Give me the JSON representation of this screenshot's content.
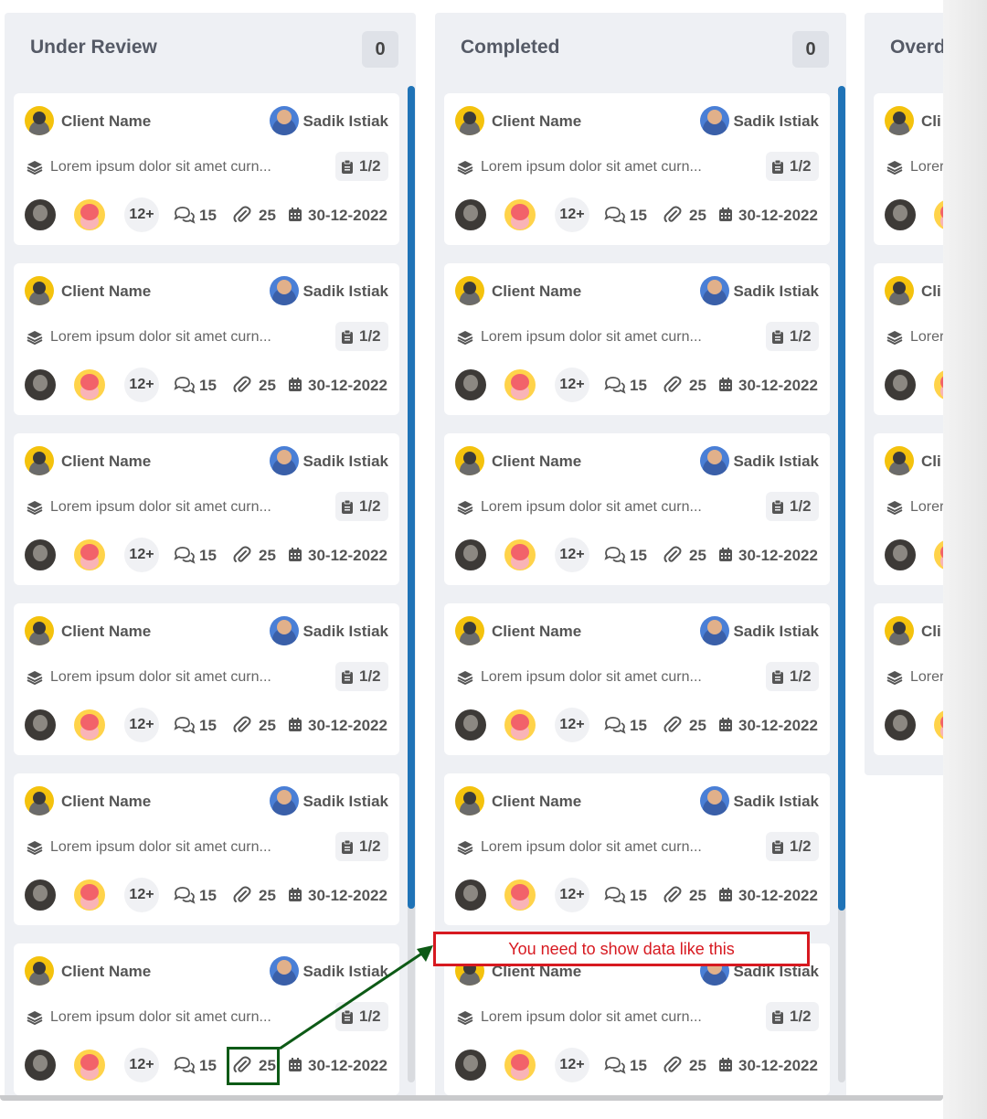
{
  "columns": [
    {
      "title": "Under Review",
      "count": "0",
      "cards": [
        {
          "client": "Client Name",
          "assignee": "Sadik Istiak",
          "description": "Lorem ipsum dolor sit amet curn...",
          "checklist": "1/2",
          "members_more": "12+",
          "comments": "15",
          "attachments": "25",
          "date": "30-12-2022"
        },
        {
          "client": "Client Name",
          "assignee": "Sadik Istiak",
          "description": "Lorem ipsum dolor sit amet curn...",
          "checklist": "1/2",
          "members_more": "12+",
          "comments": "15",
          "attachments": "25",
          "date": "30-12-2022"
        },
        {
          "client": "Client Name",
          "assignee": "Sadik Istiak",
          "description": "Lorem ipsum dolor sit amet curn...",
          "checklist": "1/2",
          "members_more": "12+",
          "comments": "15",
          "attachments": "25",
          "date": "30-12-2022"
        },
        {
          "client": "Client Name",
          "assignee": "Sadik Istiak",
          "description": "Lorem ipsum dolor sit amet curn...",
          "checklist": "1/2",
          "members_more": "12+",
          "comments": "15",
          "attachments": "25",
          "date": "30-12-2022"
        },
        {
          "client": "Client Name",
          "assignee": "Sadik Istiak",
          "description": "Lorem ipsum dolor sit amet curn...",
          "checklist": "1/2",
          "members_more": "12+",
          "comments": "15",
          "attachments": "25",
          "date": "30-12-2022"
        },
        {
          "client": "Client Name",
          "assignee": "Sadik Istiak",
          "description": "Lorem ipsum dolor sit amet curn...",
          "checklist": "1/2",
          "members_more": "12+",
          "comments": "15",
          "attachments": "25",
          "date": "30-12-2022"
        }
      ]
    },
    {
      "title": "Completed",
      "count": "0",
      "cards": [
        {
          "client": "Client Name",
          "assignee": "Sadik Istiak",
          "description": "Lorem ipsum dolor sit amet curn...",
          "checklist": "1/2",
          "members_more": "12+",
          "comments": "15",
          "attachments": "25",
          "date": "30-12-2022"
        },
        {
          "client": "Client Name",
          "assignee": "Sadik Istiak",
          "description": "Lorem ipsum dolor sit amet curn...",
          "checklist": "1/2",
          "members_more": "12+",
          "comments": "15",
          "attachments": "25",
          "date": "30-12-2022"
        },
        {
          "client": "Client Name",
          "assignee": "Sadik Istiak",
          "description": "Lorem ipsum dolor sit amet curn...",
          "checklist": "1/2",
          "members_more": "12+",
          "comments": "15",
          "attachments": "25",
          "date": "30-12-2022"
        },
        {
          "client": "Client Name",
          "assignee": "Sadik Istiak",
          "description": "Lorem ipsum dolor sit amet curn...",
          "checklist": "1/2",
          "members_more": "12+",
          "comments": "15",
          "attachments": "25",
          "date": "30-12-2022"
        },
        {
          "client": "Client Name",
          "assignee": "Sadik Istiak",
          "description": "Lorem ipsum dolor sit amet curn...",
          "checklist": "1/2",
          "members_more": "12+",
          "comments": "15",
          "attachments": "25",
          "date": "30-12-2022"
        },
        {
          "client": "Client Name",
          "assignee": "Sadik Istiak",
          "description": "Lorem ipsum dolor sit amet curn...",
          "checklist": "1/2",
          "members_more": "12+",
          "comments": "15",
          "attachments": "25",
          "date": "30-12-2022"
        }
      ]
    },
    {
      "title": "Overd",
      "count": "",
      "cards": [
        {
          "client": "Cli",
          "description": "Lorer"
        },
        {
          "client": "Cli",
          "description": "Lorer"
        },
        {
          "client": "Cli",
          "description": "Lorer"
        },
        {
          "client": "Cli",
          "description": "Lorer"
        }
      ]
    }
  ],
  "annotation": {
    "text": "You need to show data like this",
    "box_color": "#d71920",
    "highlight_color": "#0d5a16"
  },
  "colors": {
    "accent": "#1f73b7",
    "column_bg": "#eef0f4",
    "card_bg": "#ffffff"
  },
  "icons": {
    "description": "layers-icon",
    "checklist": "clipboard-icon",
    "comments": "comments-icon",
    "attachments": "paperclip-icon",
    "date": "calendar-icon"
  }
}
